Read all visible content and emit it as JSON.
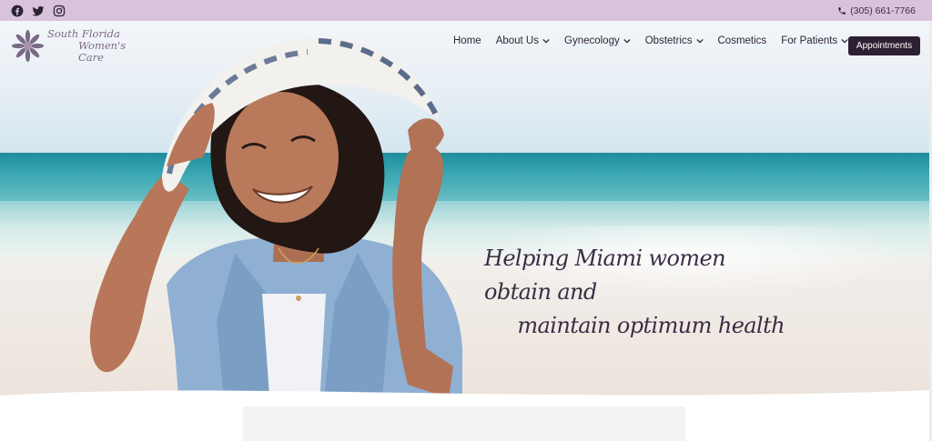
{
  "topbar": {
    "social_icons": [
      "facebook-icon",
      "twitter-icon",
      "instagram-icon"
    ],
    "phone_icon": "phone-icon",
    "phone": "(305) 661-7766",
    "background": "#d9c2dc"
  },
  "header": {
    "logo": {
      "line1": "South Florida",
      "line2": "Women's Care"
    },
    "nav": [
      {
        "label": "Home",
        "dropdown": false
      },
      {
        "label": "About Us",
        "dropdown": true
      },
      {
        "label": "Gynecology",
        "dropdown": true
      },
      {
        "label": "Obstetrics",
        "dropdown": true
      },
      {
        "label": "Cosmetics",
        "dropdown": false
      },
      {
        "label": "For Patients",
        "dropdown": true
      }
    ],
    "cta_label": "Appointments",
    "cta_color": "#2c2032"
  },
  "hero": {
    "tagline_line1": "Helping Miami women obtain and",
    "tagline_line2": "maintain optimum health"
  }
}
